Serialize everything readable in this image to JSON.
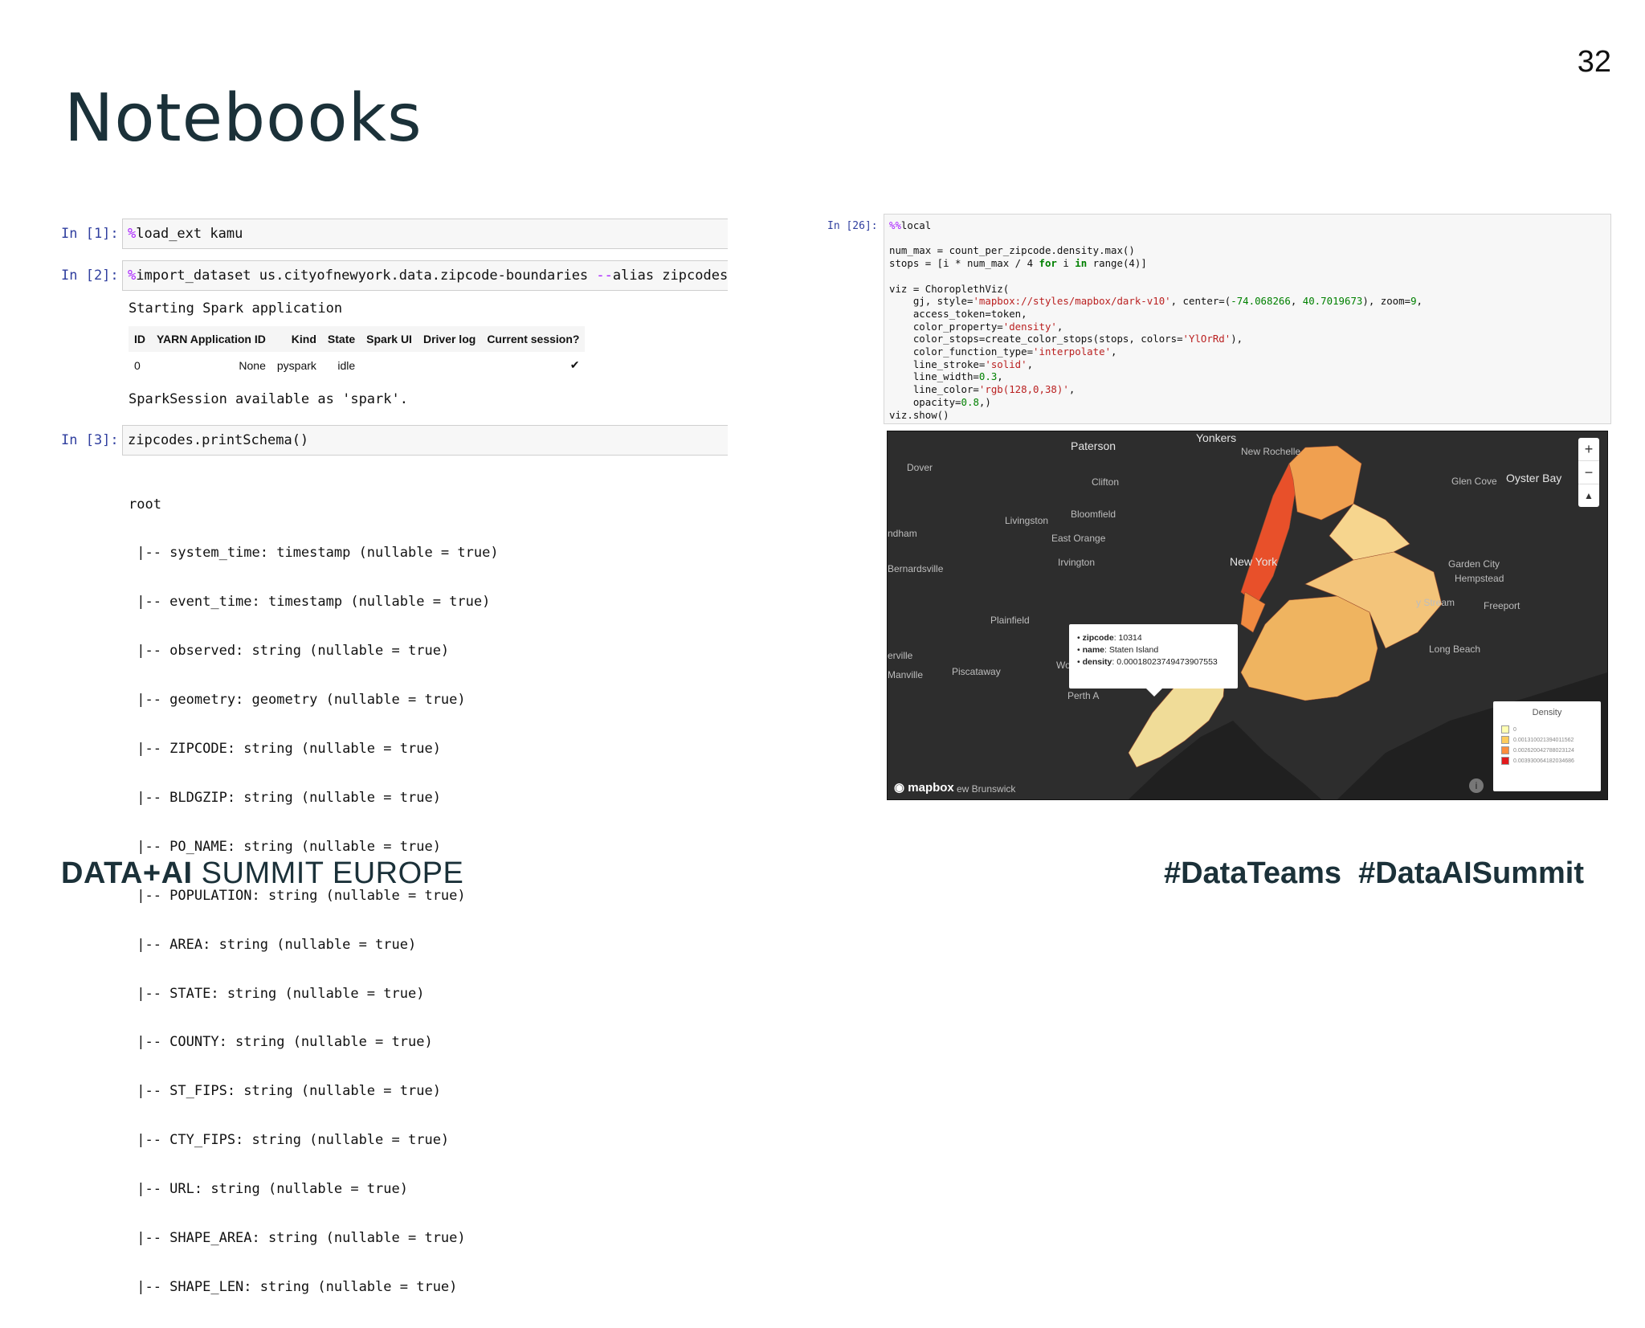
{
  "slide": {
    "title": "Notebooks",
    "page_number": "32"
  },
  "left_notebook": {
    "cell1": {
      "prompt": "In [1]:",
      "magic": "%",
      "code": "load_ext kamu"
    },
    "cell2": {
      "prompt": "In [2]:",
      "magic": "%",
      "code_a": "import_dataset us.cityofnewyork.data.zipcode-boundaries ",
      "flag": "--",
      "code_b": "alias zipcodes",
      "output_start": "Starting Spark application",
      "table": {
        "headers": [
          "ID",
          "YARN Application ID",
          "Kind",
          "State",
          "Spark UI",
          "Driver log",
          "Current session?"
        ],
        "row": [
          "0",
          "None",
          "pyspark",
          "idle",
          "",
          "",
          "✔"
        ]
      },
      "output_end": "SparkSession available as 'spark'."
    },
    "cell3": {
      "prompt": "In [3]:",
      "code": "zipcodes.printSchema()",
      "schema": [
        "root",
        " |-- system_time: timestamp (nullable = true)",
        " |-- event_time: timestamp (nullable = true)",
        " |-- observed: string (nullable = true)",
        " |-- geometry: geometry (nullable = true)",
        " |-- ZIPCODE: string (nullable = true)",
        " |-- BLDGZIP: string (nullable = true)",
        " |-- PO_NAME: string (nullable = true)",
        " |-- POPULATION: string (nullable = true)",
        " |-- AREA: string (nullable = true)",
        " |-- STATE: string (nullable = true)",
        " |-- COUNTY: string (nullable = true)",
        " |-- ST_FIPS: string (nullable = true)",
        " |-- CTY_FIPS: string (nullable = true)",
        " |-- URL: string (nullable = true)",
        " |-- SHAPE_AREA: string (nullable = true)",
        " |-- SHAPE_LEN: string (nullable = true)"
      ]
    }
  },
  "right_notebook": {
    "prompt": "In [26]:",
    "code": {
      "l1_magic": "%%",
      "l1": "local",
      "l3": "num_max = count_per_zipcode.density.max()",
      "l4a": "stops = [i * num_max / 4 ",
      "l4k1": "for",
      "l4b": " i ",
      "l4k2": "in",
      "l4c": " range(4)]",
      "l6": "viz = ChoroplethViz(",
      "l7a": "    gj, style=",
      "l7s": "'mapbox://styles/mapbox/dark-v10'",
      "l7b": ", center=(",
      "l7n1": "-74.068266",
      "l7c": ", ",
      "l7n2": "40.7019673",
      "l7d": "), zoom=",
      "l7n3": "9",
      "l7e": ",",
      "l8": "    access_token=token,",
      "l9a": "    color_property=",
      "l9s": "'density'",
      "l10a": "    color_stops=create_color_stops(stops, colors=",
      "l10s": "'YlOrRd'",
      "l10b": "),",
      "l11a": "    color_function_type=",
      "l11s": "'interpolate'",
      "l12a": "    line_stroke=",
      "l12s": "'solid'",
      "l13a": "    line_width=",
      "l13n": "0.3",
      "l14a": "    line_color=",
      "l14s": "'rgb(128,0,38)'",
      "l15a": "    opacity=",
      "l15n": "0.8",
      "l15b": ",)",
      "l16": "viz.show()"
    },
    "map": {
      "places": {
        "yonkers": "Yonkers",
        "paterson": "Paterson",
        "new_rochelle": "New Rochelle",
        "dover": "Dover",
        "clifton": "Clifton",
        "glen_cove": "Glen Cove",
        "oyster_bay": "Oyster Bay",
        "bloomfield": "Bloomfield",
        "livingston": "Livingston",
        "east_orange": "East Orange",
        "ndham": "ndham",
        "irvington": "Irvington",
        "new_york": "New York",
        "garden_city": "Garden City",
        "hempstead": "Hempstead",
        "bernardsville": "Bernardsville",
        "valley_stream": "y Stream",
        "freeport": "Freeport",
        "plainfield": "Plainfield",
        "long_beach": "Long Beach",
        "erville": "erville",
        "woodbridge": "Woodbridge",
        "manville": "Manville",
        "piscataway": "Piscataway",
        "perth_amboy": "Perth A",
        "new_brunswick": "ew Brunswick"
      },
      "tooltip": {
        "zipcode_label": "zipcode",
        "zipcode_value": ": 10314",
        "name_label": "name",
        "name_value": ": Staten Island",
        "density_label": "density",
        "density_value": ": 0.00018023749473907553"
      },
      "legend": {
        "title": "Density",
        "items": [
          {
            "label": "0",
            "color": "#ffffb2"
          },
          {
            "label": "0.001310021394011562",
            "color": "#fecc5c"
          },
          {
            "label": "0.002620042788023124",
            "color": "#fd8d3c"
          },
          {
            "label": "0.003930064182034686",
            "color": "#e31a1c"
          }
        ]
      },
      "zoom_in": "+",
      "zoom_out": "−",
      "compass": "▲",
      "logo": "mapbox",
      "info": "i"
    }
  },
  "footer": {
    "brand_bold": "DATA+AI",
    "brand_rest": " SUMMIT EUROPE",
    "hashtags": "#DataTeams  #DataAISummit"
  }
}
